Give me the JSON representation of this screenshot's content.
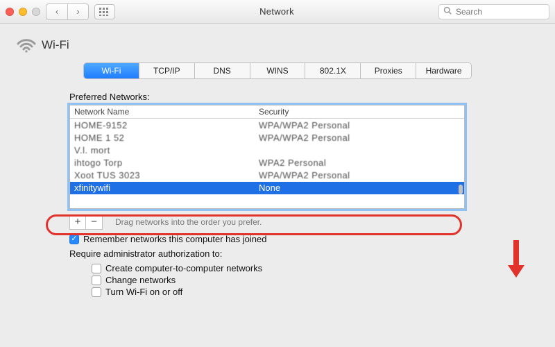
{
  "window": {
    "title": "Network",
    "search_placeholder": "Search"
  },
  "heading": {
    "label": "Wi-Fi"
  },
  "tabs": [
    "Wi-Fi",
    "TCP/IP",
    "DNS",
    "WINS",
    "802.1X",
    "Proxies",
    "Hardware"
  ],
  "active_tab_index": 0,
  "preferred_networks_label": "Preferred Networks:",
  "columns": {
    "name": "Network Name",
    "security": "Security"
  },
  "networks": [
    {
      "name": "HOME-9152",
      "security": "WPA/WPA2 Personal",
      "smudged": true
    },
    {
      "name": "HOME 1 52",
      "security": "WPA/WPA2 Personal",
      "smudged": true
    },
    {
      "name": "V.l. mort",
      "security": "",
      "smudged": true
    },
    {
      "name": "ihtogo Torp",
      "security": "WPA2 Personal",
      "smudged": true
    },
    {
      "name": "Xoot TUS 3023",
      "security": "WPA/WPA2 Personal",
      "smudged": true
    },
    {
      "name": "xfinitywifi",
      "security": "None",
      "smudged": false,
      "selected": true
    }
  ],
  "buttons": {
    "add": "+",
    "remove": "−"
  },
  "hint": "Drag networks into the order you prefer.",
  "remember": {
    "label": "Remember networks this computer has joined",
    "checked": true
  },
  "require_label": "Require administrator authorization to:",
  "require_opts": [
    {
      "label": "Create computer-to-computer networks",
      "checked": false
    },
    {
      "label": "Change networks",
      "checked": false
    },
    {
      "label": "Turn Wi-Fi on or off",
      "checked": false
    }
  ],
  "annotations": {
    "red_ring": true,
    "red_arrow": true
  }
}
